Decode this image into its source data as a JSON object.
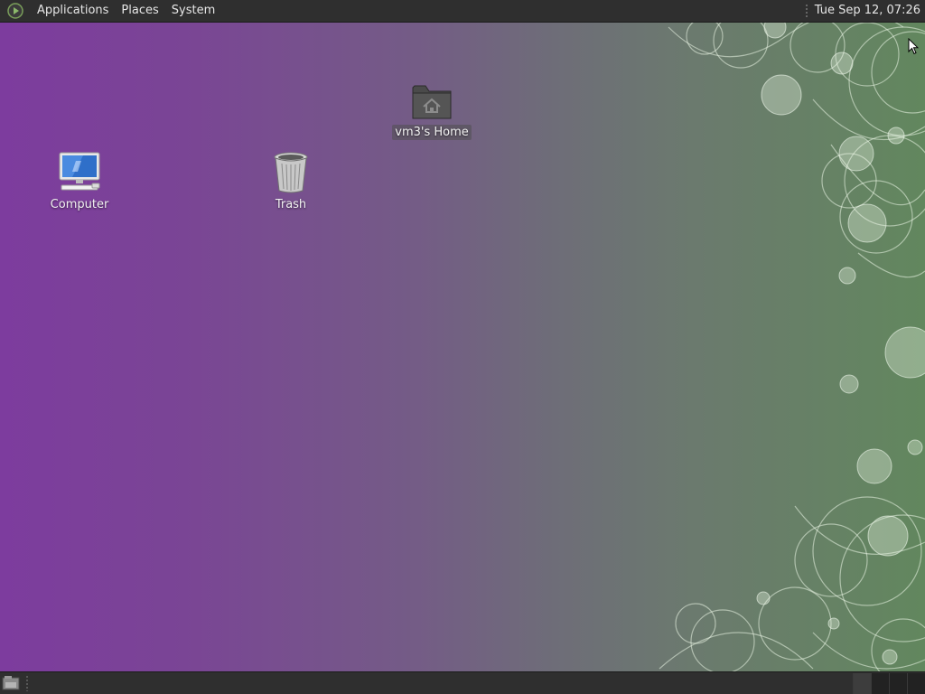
{
  "top_panel": {
    "menus": {
      "applications": "Applications",
      "places": "Places",
      "system": "System"
    },
    "clock": "Tue Sep 12, 07:26"
  },
  "desktop": {
    "icons": {
      "computer": {
        "label": "Computer",
        "icon": "computer-icon"
      },
      "trash": {
        "label": "Trash",
        "icon": "trash-icon"
      },
      "home": {
        "label": "vm3's Home",
        "icon": "home-folder-icon"
      }
    }
  },
  "bottom_panel": {
    "show_desktop_icon": "show-desktop-icon",
    "workspaces": 4,
    "active_workspace": 1
  },
  "colors": {
    "panel_bg": "#2f2f2f",
    "wallpaper_left": "#7d3c9e",
    "wallpaper_right": "#62875e"
  }
}
